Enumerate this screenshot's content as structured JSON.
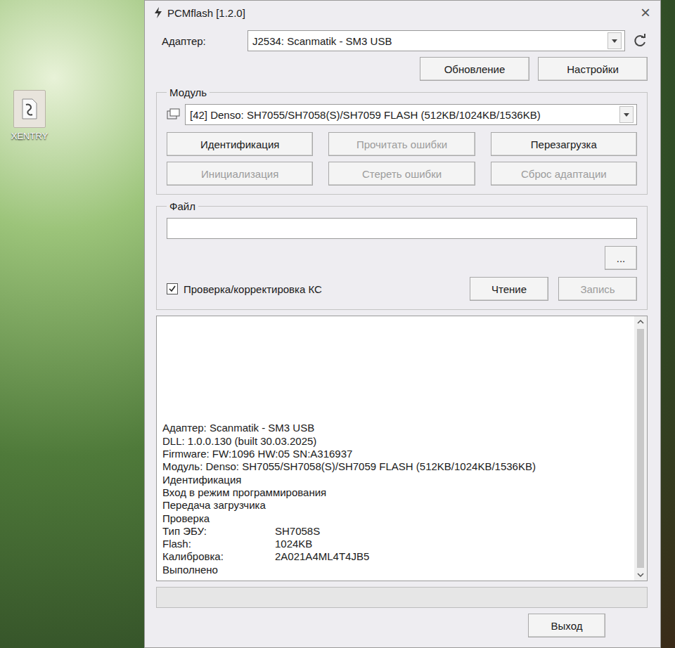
{
  "desktop": {
    "icons": [
      {
        "label": "XENTRY"
      }
    ]
  },
  "window": {
    "title": "PCMflash [1.2.0]",
    "close": "×"
  },
  "adapter": {
    "label": "Адаптер:",
    "value": "J2534: Scanmatik - SM3 USB"
  },
  "top_buttons": [
    {
      "label": "Обновление",
      "disabled": false
    },
    {
      "label": "Настройки",
      "disabled": false
    }
  ],
  "module": {
    "title": "Модуль",
    "value": "[42] Denso: SH7055/SH7058(S)/SH7059 FLASH (512KB/1024KB/1536KB)",
    "buttons": [
      {
        "label": "Идентификация",
        "disabled": false
      },
      {
        "label": "Прочитать ошибки",
        "disabled": true
      },
      {
        "label": "Перезагрузка",
        "disabled": false
      },
      {
        "label": "Инициализация",
        "disabled": true
      },
      {
        "label": "Стереть ошибки",
        "disabled": true
      },
      {
        "label": "Сброс адаптации",
        "disabled": true
      }
    ]
  },
  "file": {
    "title": "Файл",
    "path": "",
    "browse": "...",
    "checksum": {
      "label": "Проверка/корректировка КС",
      "checked": true
    },
    "buttons": [
      {
        "label": "Чтение",
        "disabled": false
      },
      {
        "label": "Запись",
        "disabled": true
      }
    ]
  },
  "log": {
    "lines": [
      {
        "kind": "text",
        "label": "Адаптер: Scanmatik - SM3 USB"
      },
      {
        "kind": "text",
        "label": "DLL: 1.0.0.130 (built 30.03.2025)"
      },
      {
        "kind": "text",
        "label": "Firmware: FW:1096 HW:05 SN:A316937"
      },
      {
        "kind": "text",
        "label": "Модуль: Denso: SH7055/SH7058(S)/SH7059 FLASH (512KB/1024KB/1536KB)"
      },
      {
        "kind": "text",
        "label": "Идентификация"
      },
      {
        "kind": "text",
        "label": "Вход в режим программирования"
      },
      {
        "kind": "text",
        "label": "Передача загрузчика"
      },
      {
        "kind": "text",
        "label": "Проверка"
      },
      {
        "kind": "pair",
        "label": "Тип ЭБУ:",
        "value": "SH7058S"
      },
      {
        "kind": "pair",
        "label": "Flash:",
        "value": "1024KB"
      },
      {
        "kind": "pair",
        "label": "Калибровка:",
        "value": "2A021A4ML4T4JB5"
      },
      {
        "kind": "text",
        "label": "Выполнено"
      }
    ]
  },
  "progress": {
    "level": 0
  },
  "exit_button": {
    "label": "Выход",
    "disabled": false
  }
}
